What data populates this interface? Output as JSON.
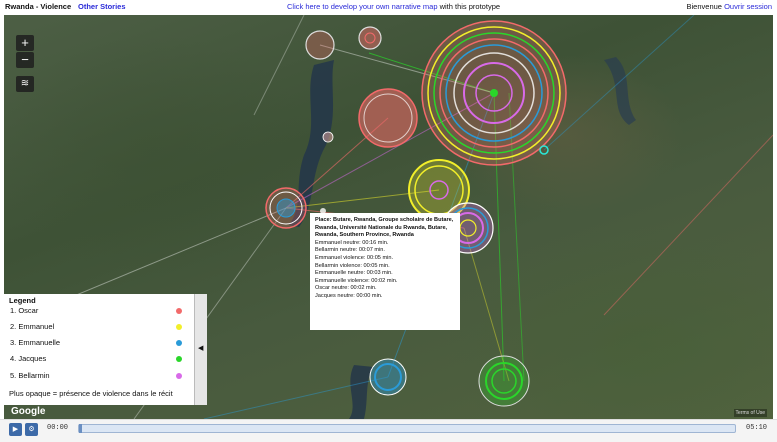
{
  "header": {
    "app_title": "Rwanda - Violence",
    "other_stories": "Other Stories",
    "develop_link": "Click here to develop your own narrative map",
    "develop_rest": " with this prototype",
    "welcome": "Bienvenue",
    "open_session": "Ouvrir session"
  },
  "map_controls": {
    "zoom_in": "+",
    "zoom_out": "−",
    "layers": "≋"
  },
  "tooltip": {
    "place": "Place: Butare, Rwanda, Groupe scholaire de Butare, Rwanda, Université Nationale du Rwanda, Butare, Rwanda, Southern Province, Rwanda",
    "lines": [
      "Emmanuel neutre: 00:16 min.",
      "Bellarmin neutre: 00:07 min.",
      "Emmanuel violence: 00:05 min.",
      "Bellarmin violence: 00:05 min.",
      "Emmanuelle neutre: 00:03 min.",
      "Emmanuelle violence: 00:02 min.",
      "Oscar neutre: 00:02 min.",
      "Jacques neutre: 00:00 min."
    ]
  },
  "legend": {
    "title": "Legend",
    "items": [
      {
        "label": "1. Oscar",
        "color": "#f26a6a"
      },
      {
        "label": "2. Emmanuel",
        "color": "#f2ef2a"
      },
      {
        "label": "3. Emmanuelle",
        "color": "#2a9bd8"
      },
      {
        "label": "4. Jacques",
        "color": "#2ad62a"
      },
      {
        "label": "5. Bellarmin",
        "color": "#d86ae8"
      }
    ],
    "note": "Plus opaque = présence de violence dans le récit",
    "toggle": "◀"
  },
  "attribution": {
    "google": "Google",
    "copyright": "Terms of Use"
  },
  "player": {
    "play_icon": "play-icon",
    "time_start": "00:00",
    "time_end": "05:10",
    "progress": 0.0
  }
}
